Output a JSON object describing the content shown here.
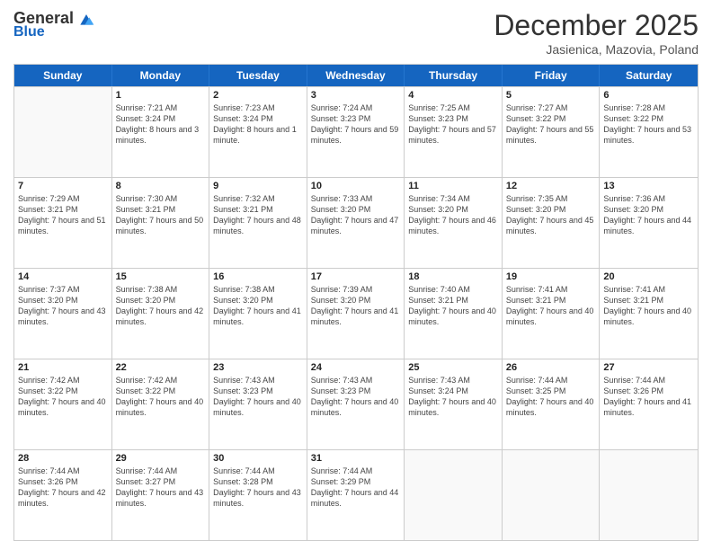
{
  "header": {
    "logo_general": "General",
    "logo_blue": "Blue",
    "month_title": "December 2025",
    "location": "Jasienica, Mazovia, Poland"
  },
  "weekdays": [
    "Sunday",
    "Monday",
    "Tuesday",
    "Wednesday",
    "Thursday",
    "Friday",
    "Saturday"
  ],
  "rows": [
    [
      {
        "day": "",
        "empty": true
      },
      {
        "day": "1",
        "sunrise": "7:21 AM",
        "sunset": "3:24 PM",
        "daylight": "8 hours and 3 minutes."
      },
      {
        "day": "2",
        "sunrise": "7:23 AM",
        "sunset": "3:24 PM",
        "daylight": "8 hours and 1 minute."
      },
      {
        "day": "3",
        "sunrise": "7:24 AM",
        "sunset": "3:23 PM",
        "daylight": "7 hours and 59 minutes."
      },
      {
        "day": "4",
        "sunrise": "7:25 AM",
        "sunset": "3:23 PM",
        "daylight": "7 hours and 57 minutes."
      },
      {
        "day": "5",
        "sunrise": "7:27 AM",
        "sunset": "3:22 PM",
        "daylight": "7 hours and 55 minutes."
      },
      {
        "day": "6",
        "sunrise": "7:28 AM",
        "sunset": "3:22 PM",
        "daylight": "7 hours and 53 minutes."
      }
    ],
    [
      {
        "day": "7",
        "sunrise": "7:29 AM",
        "sunset": "3:21 PM",
        "daylight": "7 hours and 51 minutes."
      },
      {
        "day": "8",
        "sunrise": "7:30 AM",
        "sunset": "3:21 PM",
        "daylight": "7 hours and 50 minutes."
      },
      {
        "day": "9",
        "sunrise": "7:32 AM",
        "sunset": "3:21 PM",
        "daylight": "7 hours and 48 minutes."
      },
      {
        "day": "10",
        "sunrise": "7:33 AM",
        "sunset": "3:20 PM",
        "daylight": "7 hours and 47 minutes."
      },
      {
        "day": "11",
        "sunrise": "7:34 AM",
        "sunset": "3:20 PM",
        "daylight": "7 hours and 46 minutes."
      },
      {
        "day": "12",
        "sunrise": "7:35 AM",
        "sunset": "3:20 PM",
        "daylight": "7 hours and 45 minutes."
      },
      {
        "day": "13",
        "sunrise": "7:36 AM",
        "sunset": "3:20 PM",
        "daylight": "7 hours and 44 minutes."
      }
    ],
    [
      {
        "day": "14",
        "sunrise": "7:37 AM",
        "sunset": "3:20 PM",
        "daylight": "7 hours and 43 minutes."
      },
      {
        "day": "15",
        "sunrise": "7:38 AM",
        "sunset": "3:20 PM",
        "daylight": "7 hours and 42 minutes."
      },
      {
        "day": "16",
        "sunrise": "7:38 AM",
        "sunset": "3:20 PM",
        "daylight": "7 hours and 41 minutes."
      },
      {
        "day": "17",
        "sunrise": "7:39 AM",
        "sunset": "3:20 PM",
        "daylight": "7 hours and 41 minutes."
      },
      {
        "day": "18",
        "sunrise": "7:40 AM",
        "sunset": "3:21 PM",
        "daylight": "7 hours and 40 minutes."
      },
      {
        "day": "19",
        "sunrise": "7:41 AM",
        "sunset": "3:21 PM",
        "daylight": "7 hours and 40 minutes."
      },
      {
        "day": "20",
        "sunrise": "7:41 AM",
        "sunset": "3:21 PM",
        "daylight": "7 hours and 40 minutes."
      }
    ],
    [
      {
        "day": "21",
        "sunrise": "7:42 AM",
        "sunset": "3:22 PM",
        "daylight": "7 hours and 40 minutes."
      },
      {
        "day": "22",
        "sunrise": "7:42 AM",
        "sunset": "3:22 PM",
        "daylight": "7 hours and 40 minutes."
      },
      {
        "day": "23",
        "sunrise": "7:43 AM",
        "sunset": "3:23 PM",
        "daylight": "7 hours and 40 minutes."
      },
      {
        "day": "24",
        "sunrise": "7:43 AM",
        "sunset": "3:23 PM",
        "daylight": "7 hours and 40 minutes."
      },
      {
        "day": "25",
        "sunrise": "7:43 AM",
        "sunset": "3:24 PM",
        "daylight": "7 hours and 40 minutes."
      },
      {
        "day": "26",
        "sunrise": "7:44 AM",
        "sunset": "3:25 PM",
        "daylight": "7 hours and 40 minutes."
      },
      {
        "day": "27",
        "sunrise": "7:44 AM",
        "sunset": "3:26 PM",
        "daylight": "7 hours and 41 minutes."
      }
    ],
    [
      {
        "day": "28",
        "sunrise": "7:44 AM",
        "sunset": "3:26 PM",
        "daylight": "7 hours and 42 minutes."
      },
      {
        "day": "29",
        "sunrise": "7:44 AM",
        "sunset": "3:27 PM",
        "daylight": "7 hours and 43 minutes."
      },
      {
        "day": "30",
        "sunrise": "7:44 AM",
        "sunset": "3:28 PM",
        "daylight": "7 hours and 43 minutes."
      },
      {
        "day": "31",
        "sunrise": "7:44 AM",
        "sunset": "3:29 PM",
        "daylight": "7 hours and 44 minutes."
      },
      {
        "day": "",
        "empty": true
      },
      {
        "day": "",
        "empty": true
      },
      {
        "day": "",
        "empty": true
      }
    ]
  ],
  "labels": {
    "sunrise": "Sunrise:",
    "sunset": "Sunset:",
    "daylight": "Daylight:"
  }
}
